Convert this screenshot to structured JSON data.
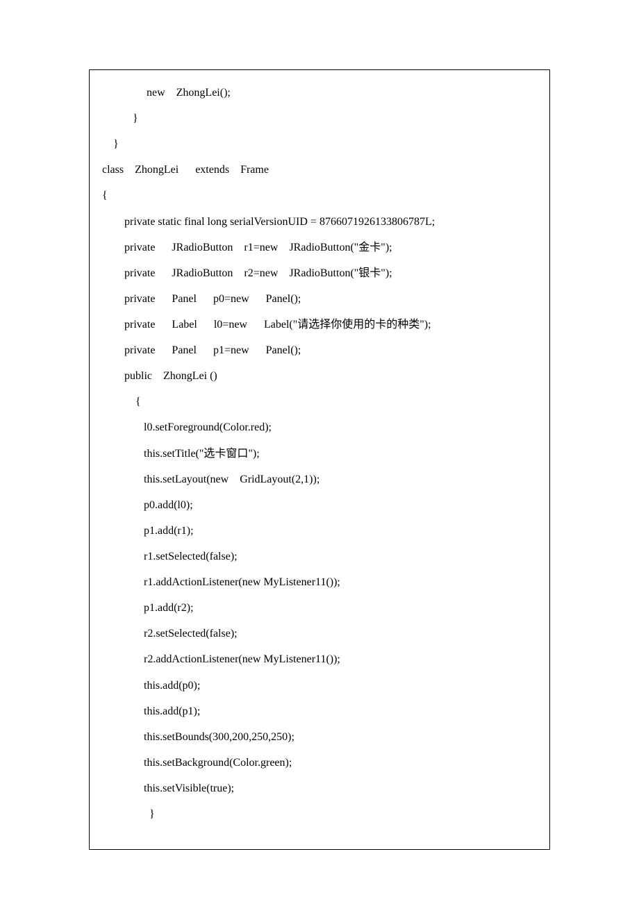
{
  "code_lines": [
    "                new    ZhongLei();",
    "           }",
    "    }",
    "class    ZhongLei      extends    Frame",
    "{",
    "        private static final long serialVersionUID = 8766071926133806787L;",
    "        private      JRadioButton    r1=new    JRadioButton(\"金卡\");",
    "        private      JRadioButton    r2=new    JRadioButton(\"银卡\");",
    "        private      Panel      p0=new      Panel();",
    "        private      Label      l0=new      Label(\"请选择你使用的卡的种类\");",
    "        private      Panel      p1=new      Panel();",
    "        public    ZhongLei ()",
    "            {",
    "               l0.setForeground(Color.red);",
    "               this.setTitle(\"选卡窗口\");",
    "               this.setLayout(new    GridLayout(2,1));",
    "               p0.add(l0);",
    "               p1.add(r1);",
    "               r1.setSelected(false);",
    "               r1.addActionListener(new MyListener11());",
    "               p1.add(r2);",
    "               r2.setSelected(false);",
    "               r2.addActionListener(new MyListener11());",
    "               this.add(p0);",
    "               this.add(p1);",
    "               this.setBounds(300,200,250,250);",
    "               this.setBackground(Color.green);",
    "               this.setVisible(true);",
    "                 }"
  ]
}
